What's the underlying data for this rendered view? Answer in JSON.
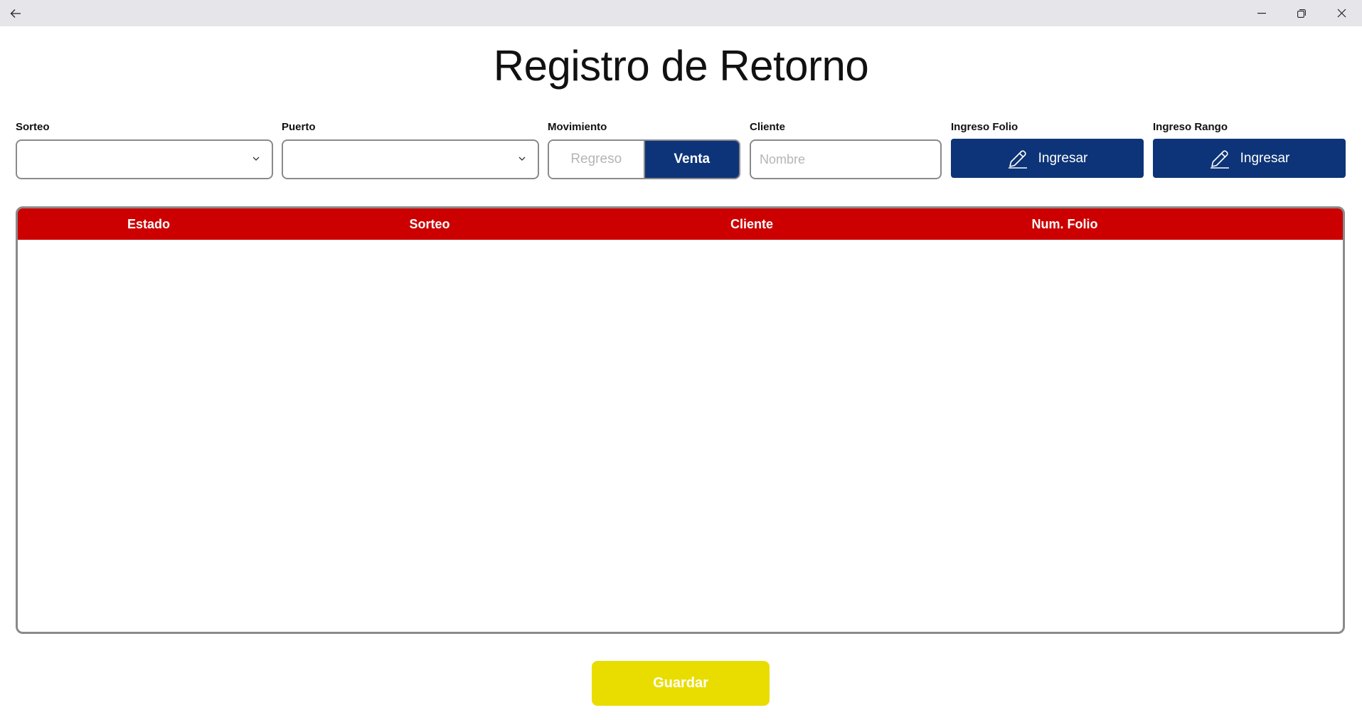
{
  "page": {
    "title": "Registro de Retorno"
  },
  "filters": {
    "sorteo": {
      "label": "Sorteo",
      "value": ""
    },
    "puerto": {
      "label": "Puerto",
      "value": ""
    },
    "movimiento": {
      "label": "Movimiento",
      "options": [
        "Regreso",
        "Venta"
      ],
      "selected": "Venta"
    },
    "cliente": {
      "label": "Cliente",
      "placeholder": "Nombre",
      "value": ""
    },
    "ingreso_folio": {
      "label": "Ingreso Folio",
      "button_label": "Ingresar"
    },
    "ingreso_rango": {
      "label": "Ingreso Rango",
      "button_label": "Ingresar"
    }
  },
  "table": {
    "columns": [
      "Estado",
      "Sorteo",
      "Cliente",
      "Num. Folio"
    ],
    "rows": []
  },
  "actions": {
    "save_label": "Guardar"
  },
  "colors": {
    "primary_blue": "#0d3478",
    "header_red": "#cc0000",
    "save_yellow": "#e9dd00",
    "border_gray": "#8a8a8a"
  },
  "icons": {
    "back": "arrow-left-icon",
    "minimize": "minimize-icon",
    "restore": "restore-icon",
    "close": "close-icon",
    "dropdown": "chevron-down-icon",
    "edit": "pencil-icon"
  }
}
